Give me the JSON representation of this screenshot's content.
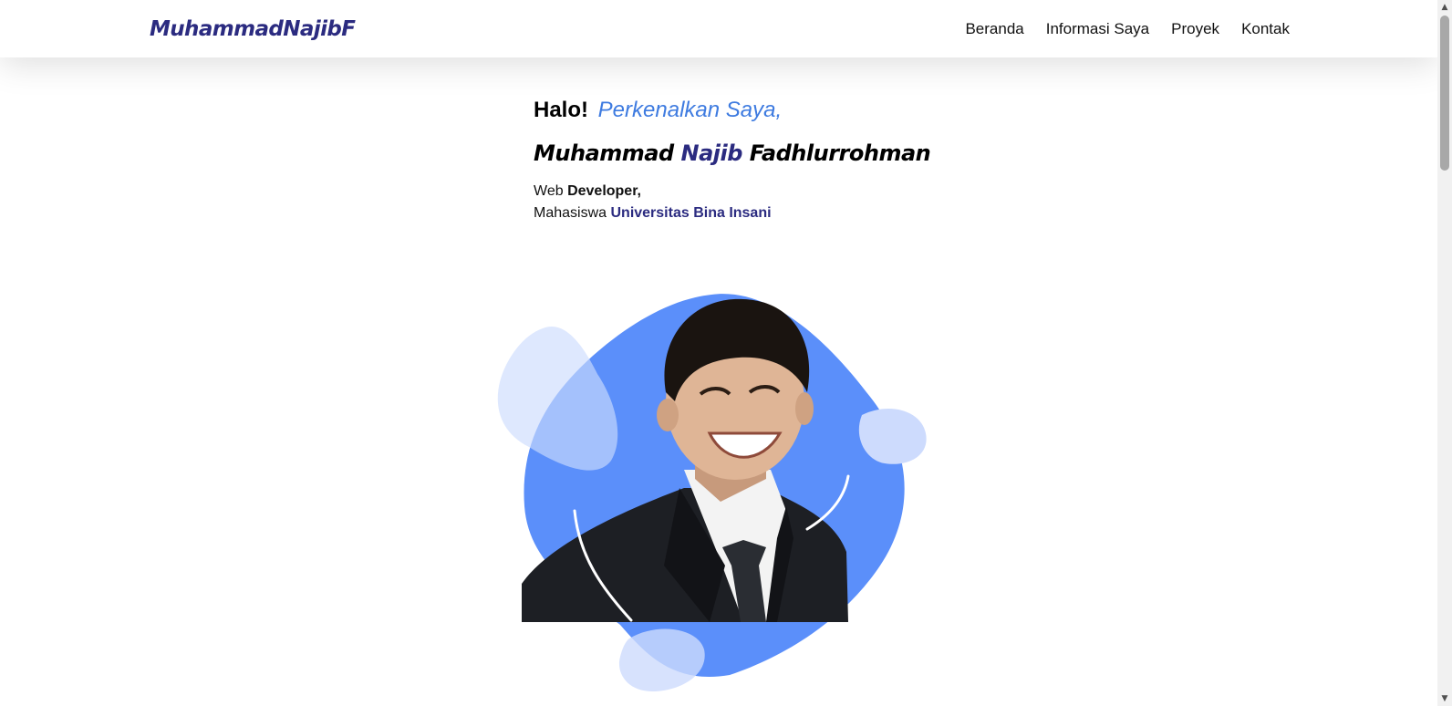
{
  "navbar": {
    "brand": "MuhammadNajibF",
    "links": [
      "Beranda",
      "Informasi Saya",
      "Proyek",
      "Kontak"
    ]
  },
  "hero": {
    "greeting_bold": "Halo!",
    "greeting_italic": "Perkenalkan Saya,",
    "name_first": "Muhammad",
    "name_accent": "Najib",
    "name_last": "Fadhlurrohman",
    "role_prefix": "Web",
    "role_bold": "Developer,",
    "study_prefix": "Mahasiswa",
    "university": "Universitas Bina Insani",
    "photo_icon": "profile-photo"
  },
  "colors": {
    "brand": "#2b2b80",
    "accent_blue": "#3e7be0",
    "blob_main": "#5b8ffa",
    "blob_light": "#cddbfd"
  },
  "scrollbar": {
    "up_icon": "scroll-up-arrow-icon",
    "down_icon": "scroll-down-arrow-icon"
  }
}
